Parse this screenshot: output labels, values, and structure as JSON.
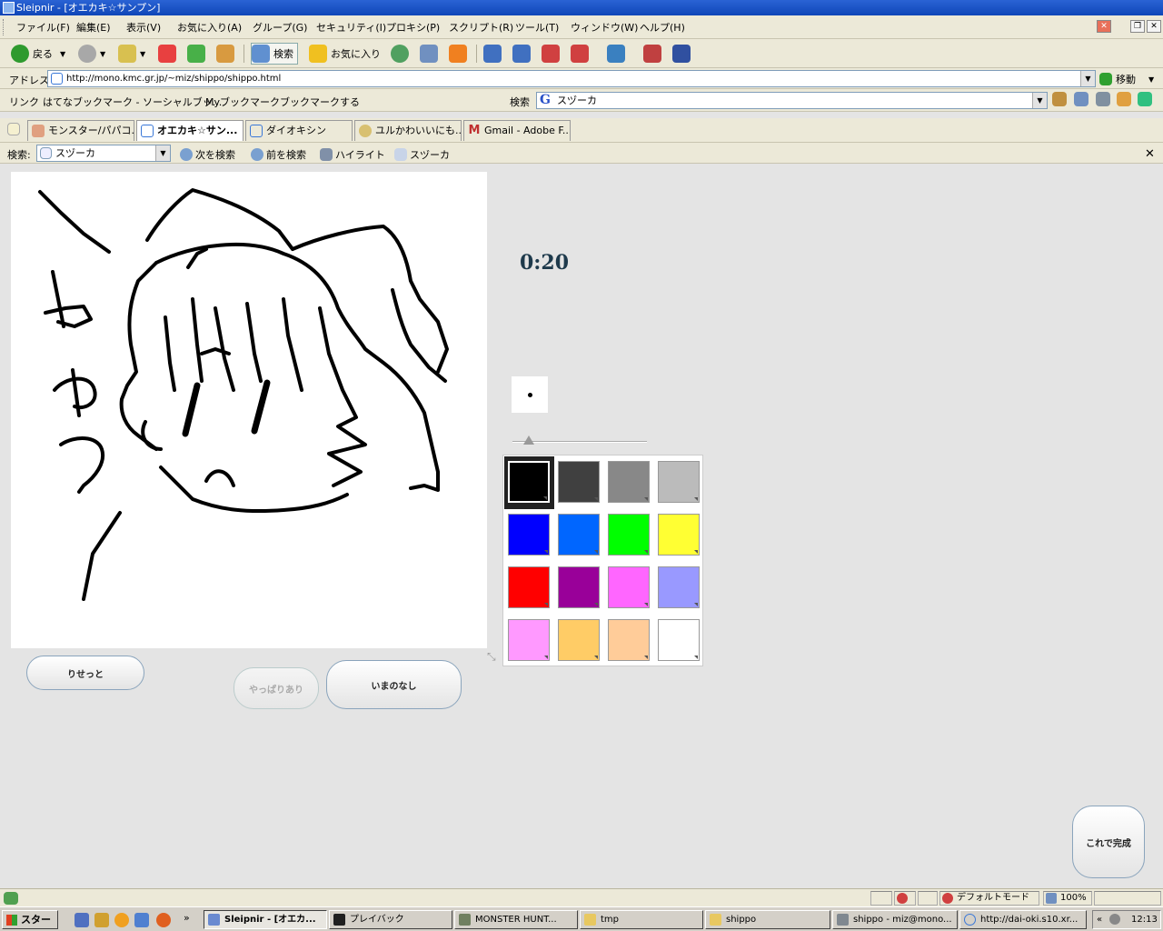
{
  "window": {
    "title": "Sleipnir - [オエカキ☆サンプン]"
  },
  "menu": {
    "items": [
      "ファイル(F)",
      "編集(E)",
      "表示(V)",
      "お気に入り(A)",
      "グループ(G)",
      "セキュリティ(I)",
      "プロキシ(P)",
      "スクリプト(R)",
      "ツール(T)",
      "ウィンドウ(W)",
      "ヘルプ(H)"
    ]
  },
  "toolbar": {
    "back_label": "戻る",
    "search_label": "検索",
    "favorites_label": "お気に入り"
  },
  "address": {
    "label": "アドレス",
    "url": "http://mono.kmc.gr.jp/~miz/shippo/shippo.html",
    "go_label": "移動"
  },
  "links": {
    "label": "リンク",
    "items": [
      "はてなブックマーク - ソーシャルブッ...",
      "Myブックマーク",
      "ブックマークする"
    ],
    "search_label": "検索",
    "search_value": "スヅーカ"
  },
  "tabs": [
    {
      "label": "モンスター/パパコ...",
      "active": false
    },
    {
      "label": "オエカキ☆サン...",
      "active": true
    },
    {
      "label": "ダイオキシン",
      "active": false
    },
    {
      "label": "ユルかわいいにも...",
      "active": false
    },
    {
      "label": "Gmail - Adobe F...",
      "active": false
    }
  ],
  "findbar": {
    "label": "検索:",
    "value": "スヅーカ",
    "next_label": "次を検索",
    "prev_label": "前を検索",
    "highlight_label": "ハイライト",
    "word_label": "スヅーカ"
  },
  "app": {
    "timer": "0:20",
    "brush_size_fraction": 0.1,
    "palette": [
      {
        "name": "black",
        "color": "#000000",
        "selected": true
      },
      {
        "name": "dark-gray",
        "color": "#404040"
      },
      {
        "name": "gray",
        "color": "#888888"
      },
      {
        "name": "light-gray",
        "color": "#bbbbbb"
      },
      {
        "name": "blue",
        "color": "#0000ff"
      },
      {
        "name": "sky-blue",
        "color": "#0066ff"
      },
      {
        "name": "green",
        "color": "#00ff00"
      },
      {
        "name": "yellow",
        "color": "#ffff33"
      },
      {
        "name": "red",
        "color": "#ff0000"
      },
      {
        "name": "purple",
        "color": "#990099"
      },
      {
        "name": "pink",
        "color": "#ff66ff"
      },
      {
        "name": "lavender",
        "color": "#9999ff"
      },
      {
        "name": "light-pink",
        "color": "#ff99ff"
      },
      {
        "name": "orange",
        "color": "#ffcc66"
      },
      {
        "name": "peach",
        "color": "#ffcc99"
      },
      {
        "name": "white",
        "color": "#ffffff"
      }
    ],
    "reset_label": "りせっと",
    "redo_label": "やっぱりあり",
    "undo_label": "いまのなし",
    "done_label": "これで完成"
  },
  "status": {
    "mode_label": "デフォルトモード",
    "zoom": "100%"
  },
  "taskbar": {
    "start_label": "スタート",
    "tasks": [
      "Sleipnir - [オエカ...",
      "プレイバック",
      "MONSTER HUNT...",
      "tmp",
      "shippo",
      "shippo - miz@mono...",
      "http://dai-oki.s10.xr..."
    ],
    "clock": "12:13"
  }
}
